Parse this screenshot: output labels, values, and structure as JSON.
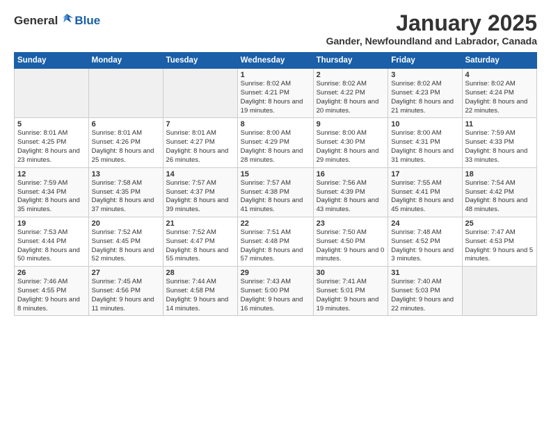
{
  "header": {
    "logo_general": "General",
    "logo_blue": "Blue",
    "month": "January 2025",
    "location": "Gander, Newfoundland and Labrador, Canada"
  },
  "days_of_week": [
    "Sunday",
    "Monday",
    "Tuesday",
    "Wednesday",
    "Thursday",
    "Friday",
    "Saturday"
  ],
  "weeks": [
    [
      {
        "day": "",
        "sunrise": "",
        "sunset": "",
        "daylight": ""
      },
      {
        "day": "",
        "sunrise": "",
        "sunset": "",
        "daylight": ""
      },
      {
        "day": "",
        "sunrise": "",
        "sunset": "",
        "daylight": ""
      },
      {
        "day": "1",
        "sunrise": "Sunrise: 8:02 AM",
        "sunset": "Sunset: 4:21 PM",
        "daylight": "Daylight: 8 hours and 19 minutes."
      },
      {
        "day": "2",
        "sunrise": "Sunrise: 8:02 AM",
        "sunset": "Sunset: 4:22 PM",
        "daylight": "Daylight: 8 hours and 20 minutes."
      },
      {
        "day": "3",
        "sunrise": "Sunrise: 8:02 AM",
        "sunset": "Sunset: 4:23 PM",
        "daylight": "Daylight: 8 hours and 21 minutes."
      },
      {
        "day": "4",
        "sunrise": "Sunrise: 8:02 AM",
        "sunset": "Sunset: 4:24 PM",
        "daylight": "Daylight: 8 hours and 22 minutes."
      }
    ],
    [
      {
        "day": "5",
        "sunrise": "Sunrise: 8:01 AM",
        "sunset": "Sunset: 4:25 PM",
        "daylight": "Daylight: 8 hours and 23 minutes."
      },
      {
        "day": "6",
        "sunrise": "Sunrise: 8:01 AM",
        "sunset": "Sunset: 4:26 PM",
        "daylight": "Daylight: 8 hours and 25 minutes."
      },
      {
        "day": "7",
        "sunrise": "Sunrise: 8:01 AM",
        "sunset": "Sunset: 4:27 PM",
        "daylight": "Daylight: 8 hours and 26 minutes."
      },
      {
        "day": "8",
        "sunrise": "Sunrise: 8:00 AM",
        "sunset": "Sunset: 4:29 PM",
        "daylight": "Daylight: 8 hours and 28 minutes."
      },
      {
        "day": "9",
        "sunrise": "Sunrise: 8:00 AM",
        "sunset": "Sunset: 4:30 PM",
        "daylight": "Daylight: 8 hours and 29 minutes."
      },
      {
        "day": "10",
        "sunrise": "Sunrise: 8:00 AM",
        "sunset": "Sunset: 4:31 PM",
        "daylight": "Daylight: 8 hours and 31 minutes."
      },
      {
        "day": "11",
        "sunrise": "Sunrise: 7:59 AM",
        "sunset": "Sunset: 4:33 PM",
        "daylight": "Daylight: 8 hours and 33 minutes."
      }
    ],
    [
      {
        "day": "12",
        "sunrise": "Sunrise: 7:59 AM",
        "sunset": "Sunset: 4:34 PM",
        "daylight": "Daylight: 8 hours and 35 minutes."
      },
      {
        "day": "13",
        "sunrise": "Sunrise: 7:58 AM",
        "sunset": "Sunset: 4:35 PM",
        "daylight": "Daylight: 8 hours and 37 minutes."
      },
      {
        "day": "14",
        "sunrise": "Sunrise: 7:57 AM",
        "sunset": "Sunset: 4:37 PM",
        "daylight": "Daylight: 8 hours and 39 minutes."
      },
      {
        "day": "15",
        "sunrise": "Sunrise: 7:57 AM",
        "sunset": "Sunset: 4:38 PM",
        "daylight": "Daylight: 8 hours and 41 minutes."
      },
      {
        "day": "16",
        "sunrise": "Sunrise: 7:56 AM",
        "sunset": "Sunset: 4:39 PM",
        "daylight": "Daylight: 8 hours and 43 minutes."
      },
      {
        "day": "17",
        "sunrise": "Sunrise: 7:55 AM",
        "sunset": "Sunset: 4:41 PM",
        "daylight": "Daylight: 8 hours and 45 minutes."
      },
      {
        "day": "18",
        "sunrise": "Sunrise: 7:54 AM",
        "sunset": "Sunset: 4:42 PM",
        "daylight": "Daylight: 8 hours and 48 minutes."
      }
    ],
    [
      {
        "day": "19",
        "sunrise": "Sunrise: 7:53 AM",
        "sunset": "Sunset: 4:44 PM",
        "daylight": "Daylight: 8 hours and 50 minutes."
      },
      {
        "day": "20",
        "sunrise": "Sunrise: 7:52 AM",
        "sunset": "Sunset: 4:45 PM",
        "daylight": "Daylight: 8 hours and 52 minutes."
      },
      {
        "day": "21",
        "sunrise": "Sunrise: 7:52 AM",
        "sunset": "Sunset: 4:47 PM",
        "daylight": "Daylight: 8 hours and 55 minutes."
      },
      {
        "day": "22",
        "sunrise": "Sunrise: 7:51 AM",
        "sunset": "Sunset: 4:48 PM",
        "daylight": "Daylight: 8 hours and 57 minutes."
      },
      {
        "day": "23",
        "sunrise": "Sunrise: 7:50 AM",
        "sunset": "Sunset: 4:50 PM",
        "daylight": "Daylight: 9 hours and 0 minutes."
      },
      {
        "day": "24",
        "sunrise": "Sunrise: 7:48 AM",
        "sunset": "Sunset: 4:52 PM",
        "daylight": "Daylight: 9 hours and 3 minutes."
      },
      {
        "day": "25",
        "sunrise": "Sunrise: 7:47 AM",
        "sunset": "Sunset: 4:53 PM",
        "daylight": "Daylight: 9 hours and 5 minutes."
      }
    ],
    [
      {
        "day": "26",
        "sunrise": "Sunrise: 7:46 AM",
        "sunset": "Sunset: 4:55 PM",
        "daylight": "Daylight: 9 hours and 8 minutes."
      },
      {
        "day": "27",
        "sunrise": "Sunrise: 7:45 AM",
        "sunset": "Sunset: 4:56 PM",
        "daylight": "Daylight: 9 hours and 11 minutes."
      },
      {
        "day": "28",
        "sunrise": "Sunrise: 7:44 AM",
        "sunset": "Sunset: 4:58 PM",
        "daylight": "Daylight: 9 hours and 14 minutes."
      },
      {
        "day": "29",
        "sunrise": "Sunrise: 7:43 AM",
        "sunset": "Sunset: 5:00 PM",
        "daylight": "Daylight: 9 hours and 16 minutes."
      },
      {
        "day": "30",
        "sunrise": "Sunrise: 7:41 AM",
        "sunset": "Sunset: 5:01 PM",
        "daylight": "Daylight: 9 hours and 19 minutes."
      },
      {
        "day": "31",
        "sunrise": "Sunrise: 7:40 AM",
        "sunset": "Sunset: 5:03 PM",
        "daylight": "Daylight: 9 hours and 22 minutes."
      },
      {
        "day": "",
        "sunrise": "",
        "sunset": "",
        "daylight": ""
      }
    ]
  ]
}
